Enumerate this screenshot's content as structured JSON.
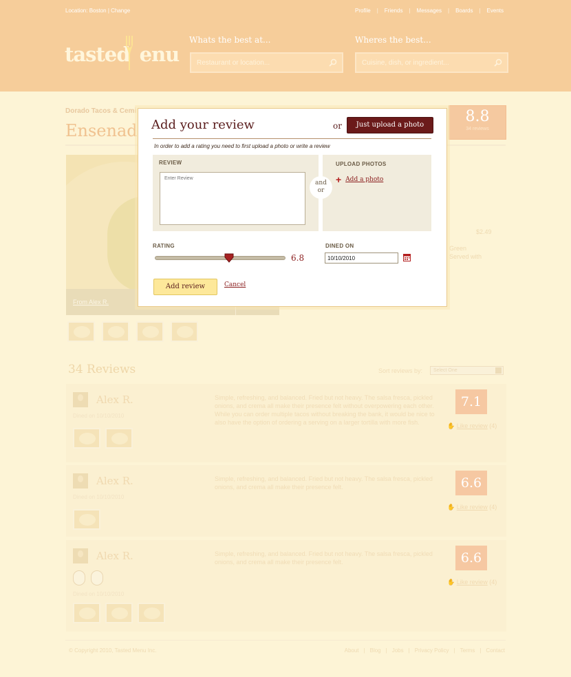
{
  "header": {
    "location": "Location: Boston | Change",
    "nav": [
      "Profile",
      "Friends",
      "Messages",
      "Boards",
      "Events"
    ],
    "logo_pre": "tasted",
    "logo_post": "menu",
    "search_what_label": "Whats the best at...",
    "search_what_placeholder": "Restaurant or location...",
    "search_where_label": "Wheres the best...",
    "search_where_placeholder": "Cuisine, dish, or ingredient..."
  },
  "page": {
    "breadcrumb": "Dorado Tacos & Cemi",
    "title": "Ensenada",
    "score": "8.8",
    "score_count": "34 reviews",
    "hero_caption": "From Alex R.",
    "price": "$2.49",
    "desc_lines": [
      ". Green",
      ". Served with"
    ]
  },
  "reviews": {
    "heading": "34 Reviews",
    "sort_label": "Sort reviews by:",
    "sort_value": "Select One",
    "items": [
      {
        "name": "Alex R.",
        "dined": "Dined on 10/10/2010",
        "text": "Simple, refreshing, and balanced.  Fried but not heavy. The salsa fresca, pickled onions, and crema all make their presence felt without overpowering each other.  While you can order multiple tacos without breaking the bank, it would be nice to also have the option of ordering a serving on a larger tortilla with more fish.",
        "score": "7.1",
        "like": "Like review",
        "like_count": "(4)"
      },
      {
        "name": "Alex R.",
        "dined": "Dined on 10/10/2010",
        "text": "Simple, refreshing, and balanced.  Fried but not heavy. The salsa fresca, pickled onions, and crema all make their presence felt.",
        "score": "6.6",
        "like": "Like review",
        "like_count": "(4)"
      },
      {
        "name": "Alex R.",
        "dined": "Dined on 10/10/2010",
        "text": "Simple, refreshing, and balanced.  Fried but not heavy. The salsa fresca, pickled onions, and crema all make their presence felt.",
        "score": "6.6",
        "like": "Like review",
        "like_count": "(4)"
      }
    ]
  },
  "footer": {
    "copyright": "© Copyright 2010, Tasted Menu Inc.",
    "links": [
      "About",
      "Blog",
      "Jobs",
      "Privacy Policy",
      "Terms",
      "Contact"
    ]
  },
  "modal": {
    "title": "Add your review",
    "or": "or",
    "upload_photo_button": "Just upload a photo",
    "note": "In order to add a rating you need to first upload a photo or write a review",
    "review_label": "REVIEW",
    "review_placeholder": "Enter Review",
    "and_or": "and or",
    "upload_label": "UPLOAD PHOTOS",
    "add_photo": "Add a photo",
    "rating_label": "RATING",
    "rating_value": "6.8",
    "rating_fraction": 0.57,
    "dined_label": "DINED ON",
    "dined_value": "10/10/2010",
    "add_review_button": "Add review",
    "cancel": "Cancel"
  },
  "colors": {
    "header_bg": "#f6cd9a",
    "page_bg": "#fdf4d6",
    "accent_dark": "#6b1a1a",
    "accent_red": "#8a1c1c",
    "button_yellow": "#fde89a"
  }
}
